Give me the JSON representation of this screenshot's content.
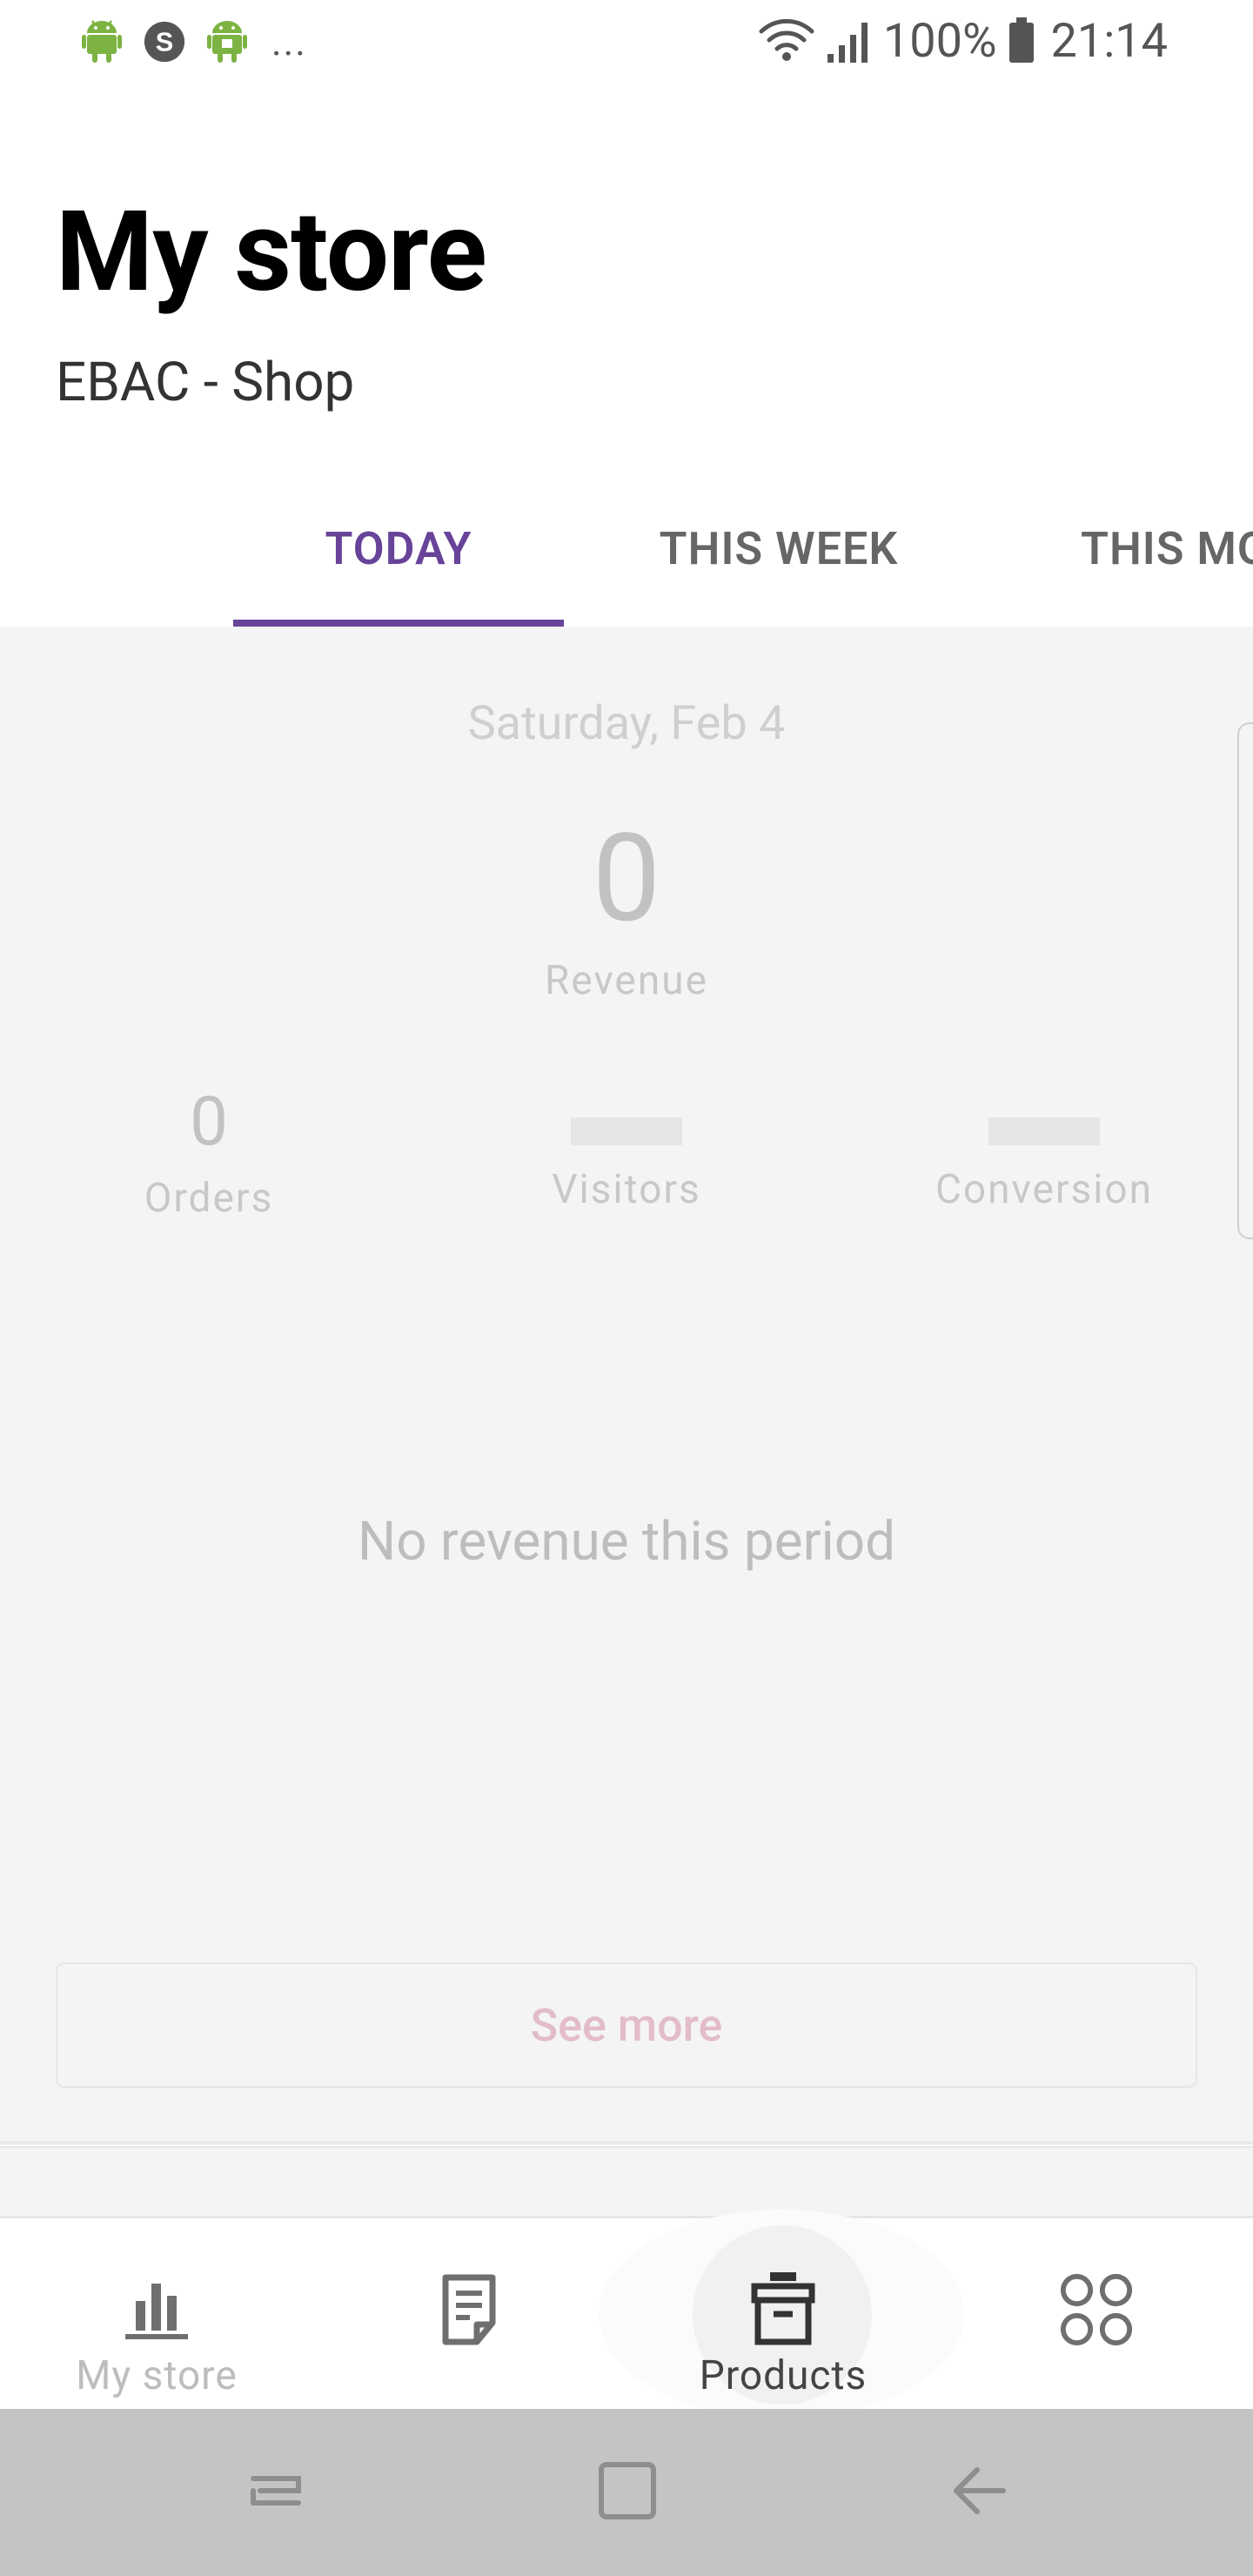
{
  "status_bar": {
    "notifications": [
      "android-icon",
      "skype-icon",
      "android-icon"
    ],
    "more": "...",
    "battery": "100%",
    "time": "21:14"
  },
  "header": {
    "title": "My store",
    "subtitle": "EBAC - Shop"
  },
  "tabs": [
    {
      "label": "TODAY",
      "active": true
    },
    {
      "label": "THIS WEEK",
      "active": false
    },
    {
      "label": "THIS MONTH",
      "active": false
    }
  ],
  "stats": {
    "date": "Saturday, Feb 4",
    "revenue_value": "0",
    "revenue_label": "Revenue",
    "orders_value": "0",
    "orders_label": "Orders",
    "visitors_label": "Visitors",
    "conversion_label": "Conversion"
  },
  "chart": {
    "empty_message": "No revenue this period"
  },
  "see_more_label": "See more",
  "bottom_nav": {
    "items": [
      {
        "icon": "bar-chart-icon",
        "label": "My store"
      },
      {
        "icon": "orders-icon",
        "label": ""
      },
      {
        "icon": "products-box-icon",
        "label": "Products"
      },
      {
        "icon": "more-grid-icon",
        "label": ""
      }
    ]
  },
  "colors": {
    "accent": "#674399",
    "tab_inactive": "#666666",
    "content_bg": "#f4f4f4",
    "see_more_text": "#e3bccb",
    "system_nav_bg": "#c4c4c4"
  }
}
